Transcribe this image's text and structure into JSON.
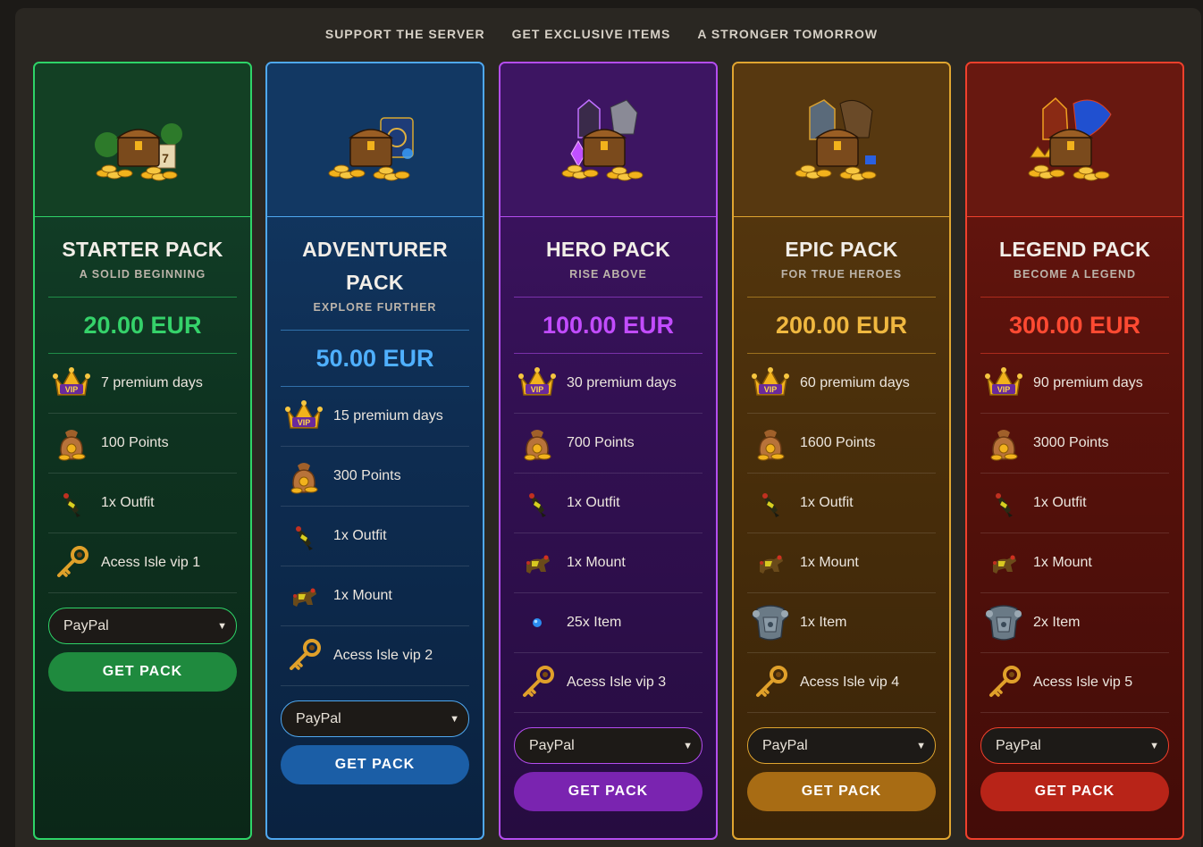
{
  "tagline": [
    "SUPPORT THE SERVER",
    "GET EXCLUSIVE ITEMS",
    "A STRONGER TOMORROW"
  ],
  "colors": {
    "page_bg": "#1c1a17",
    "starter": "#2ed468",
    "adventurer": "#4fa8f0",
    "hero": "#b44df0",
    "epic": "#e0a530",
    "legend": "#f0402c"
  },
  "packs": [
    {
      "id": "starter",
      "name": "STARTER PACK",
      "subtitle": "A SOLID BEGINNING",
      "price": "20.00 EUR",
      "features": [
        {
          "icon": "vip-crown-icon",
          "label": "7 premium days"
        },
        {
          "icon": "coin-bag-icon",
          "label": "100 Points"
        },
        {
          "icon": "outfit-icon",
          "label": "1x Outfit"
        },
        {
          "icon": "key-icon",
          "label": "Acess Isle vip 1"
        }
      ],
      "payment": "PayPal",
      "button": "GET PACK"
    },
    {
      "id": "adventurer",
      "name": "ADVENTURER PACK",
      "subtitle": "EXPLORE FURTHER",
      "price": "50.00 EUR",
      "features": [
        {
          "icon": "vip-crown-icon",
          "label": "15 premium days"
        },
        {
          "icon": "coin-bag-icon",
          "label": "300 Points"
        },
        {
          "icon": "outfit-icon",
          "label": "1x Outfit"
        },
        {
          "icon": "mount-icon",
          "label": "1x Mount"
        },
        {
          "icon": "key-icon",
          "label": "Acess Isle vip 2"
        }
      ],
      "payment": "PayPal",
      "button": "GET PACK"
    },
    {
      "id": "hero",
      "name": "HERO PACK",
      "subtitle": "RISE ABOVE",
      "price": "100.00 EUR",
      "features": [
        {
          "icon": "vip-crown-icon",
          "label": "30 premium days"
        },
        {
          "icon": "coin-bag-icon",
          "label": "700 Points"
        },
        {
          "icon": "outfit-icon",
          "label": "1x Outfit"
        },
        {
          "icon": "mount-icon",
          "label": "1x Mount"
        },
        {
          "icon": "gem-icon",
          "label": "25x Item"
        },
        {
          "icon": "key-icon",
          "label": "Acess Isle vip 3"
        }
      ],
      "payment": "PayPal",
      "button": "GET PACK"
    },
    {
      "id": "epic",
      "name": "EPIC PACK",
      "subtitle": "FOR TRUE HEROES",
      "price": "200.00 EUR",
      "features": [
        {
          "icon": "vip-crown-icon",
          "label": "60 premium days"
        },
        {
          "icon": "coin-bag-icon",
          "label": "1600 Points"
        },
        {
          "icon": "outfit-icon",
          "label": "1x Outfit"
        },
        {
          "icon": "mount-icon",
          "label": "1x Mount"
        },
        {
          "icon": "armor-icon",
          "label": "1x Item"
        },
        {
          "icon": "key-icon",
          "label": "Acess Isle vip 4"
        }
      ],
      "payment": "PayPal",
      "button": "GET PACK"
    },
    {
      "id": "legend",
      "name": "LEGEND PACK",
      "subtitle": "BECOME A LEGEND",
      "price": "300.00 EUR",
      "features": [
        {
          "icon": "vip-crown-icon",
          "label": "90 premium days"
        },
        {
          "icon": "coin-bag-icon",
          "label": "3000 Points"
        },
        {
          "icon": "outfit-icon",
          "label": "1x Outfit"
        },
        {
          "icon": "mount-icon",
          "label": "1x Mount"
        },
        {
          "icon": "armor-icon",
          "label": "2x Item"
        },
        {
          "icon": "key-icon",
          "label": "Acess Isle vip 5"
        }
      ],
      "payment": "PayPal",
      "button": "GET PACK"
    }
  ]
}
